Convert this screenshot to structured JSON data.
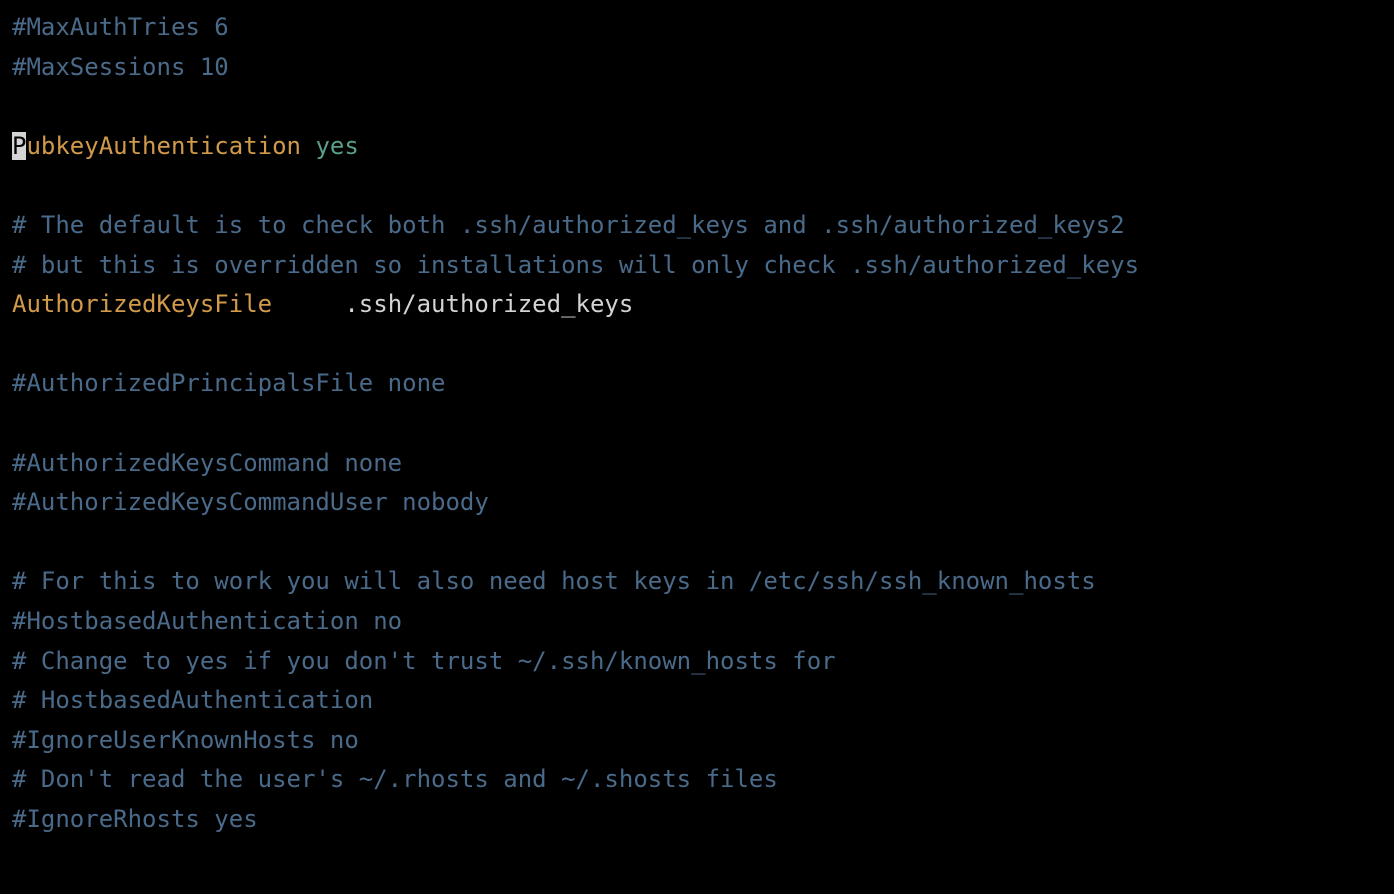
{
  "lines": {
    "l1": "#MaxAuthTries 6",
    "l2": "#MaxSessions 10",
    "l3": "",
    "l4_cursor": "P",
    "l4_key": "ubkeyAuthentication",
    "l4_val": " yes",
    "l5": "",
    "l6": "# The default is to check both .ssh/authorized_keys and .ssh/authorized_keys2",
    "l7": "# but this is overridden so installations will only check .ssh/authorized_keys",
    "l8_key": "AuthorizedKeysFile",
    "l8_pad": "     ",
    "l8_val": ".ssh/authorized_keys",
    "l9": "",
    "l10": "#AuthorizedPrincipalsFile none",
    "l11": "",
    "l12": "#AuthorizedKeysCommand none",
    "l13": "#AuthorizedKeysCommandUser nobody",
    "l14": "",
    "l15": "# For this to work you will also need host keys in /etc/ssh/ssh_known_hosts",
    "l16": "#HostbasedAuthentication no",
    "l17": "# Change to yes if you don't trust ~/.ssh/known_hosts for",
    "l18": "# HostbasedAuthentication",
    "l19": "#IgnoreUserKnownHosts no",
    "l20": "# Don't read the user's ~/.rhosts and ~/.shosts files",
    "l21": "#IgnoreRhosts yes",
    "l22": ""
  }
}
